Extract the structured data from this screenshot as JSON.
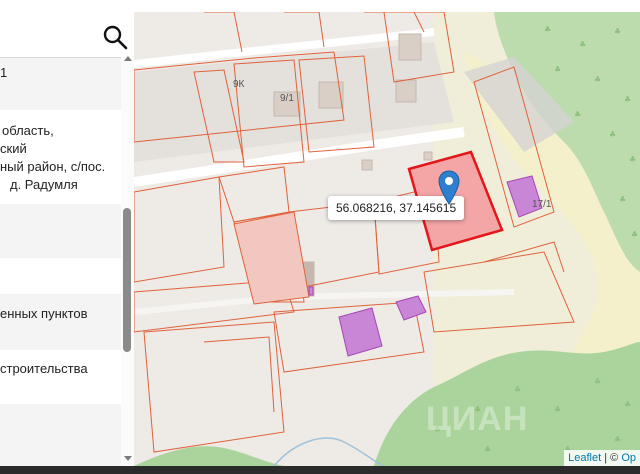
{
  "panel": {
    "search": {
      "icon": "search-icon"
    },
    "cadastral_number_fragment": "1",
    "address_lines": [
      "область,",
      "ский",
      "ный район, с/пос.",
      "д. Радумля"
    ],
    "land_category": "енных пунктов",
    "permitted_use": "строительства"
  },
  "map": {
    "popup_coordinates": "56.068216, 37.145615",
    "marker_icon": "map-marker-icon",
    "building_labels": [
      "9К",
      "9/1",
      "17/1"
    ],
    "watermark": "ЦИАН",
    "attribution": {
      "leaflet": "Leaflet",
      "separator": " | © ",
      "osm": "Op"
    },
    "colors": {
      "selected_parcel_fill": "#f4a5a5",
      "selected_parcel_stroke": "#e3161b",
      "parcel_stroke": "#e0623c",
      "building_fill": "#c985d6",
      "forest": "#a9d39c",
      "sand": "#f3efc7"
    }
  }
}
